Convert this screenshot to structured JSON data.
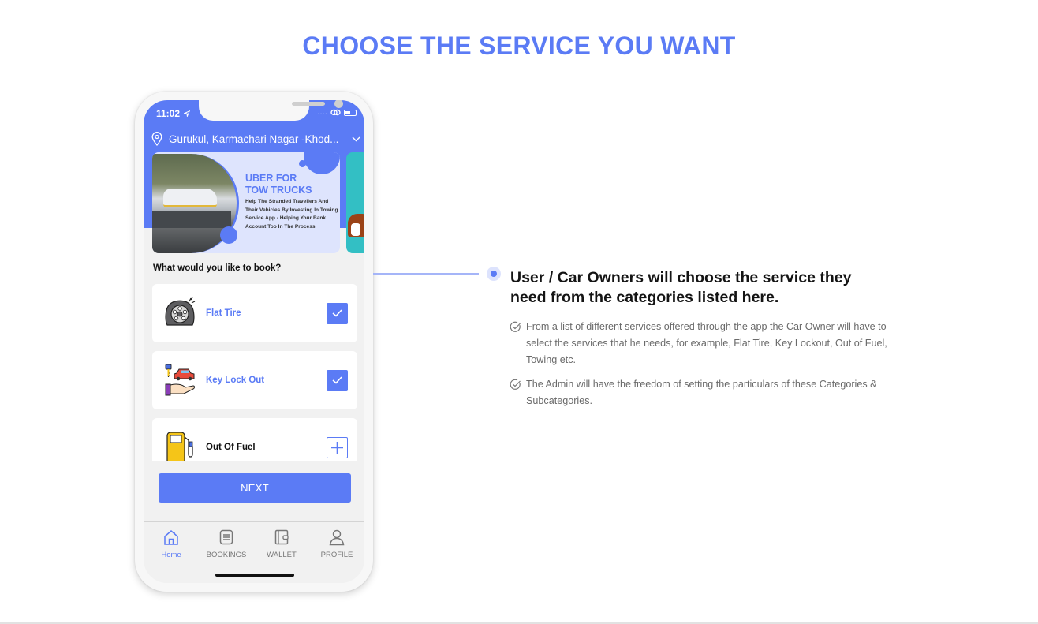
{
  "page": {
    "title": "CHOOSE THE SERVICE YOU WANT"
  },
  "colors": {
    "accent": "#5b7bf5",
    "accent_light": "#dde3fd",
    "connector": "#a5b5f8",
    "text_dark": "#141414",
    "text_muted": "#6a6a6a"
  },
  "phone": {
    "status_bar": {
      "time": "11:02",
      "signal": "....",
      "icons": [
        "location-arrow-icon",
        "link-icon",
        "battery-icon"
      ]
    },
    "location": {
      "icon": "map-pin-icon",
      "text": "Gurukul, Karmachari Nagar -Khod...",
      "dropdown_icon": "chevron-down-icon"
    },
    "banner": {
      "heading_line1": "UBER FOR",
      "heading_line2": "TOW TRUCKS",
      "subtext": "Help The Stranded Travellers And Their Vehicles By Investing In Towing Service App - Helping Your Bank Account Too In The Process"
    },
    "booking_prompt": "What would you like to book?",
    "services": [
      {
        "label": "Flat Tire",
        "icon": "flat-tire-icon",
        "selected": true
      },
      {
        "label": "Key Lock Out",
        "icon": "key-lockout-icon",
        "selected": true
      },
      {
        "label": "Out Of Fuel",
        "icon": "fuel-pump-icon",
        "selected": false
      }
    ],
    "next_button": "NEXT",
    "tabs": [
      {
        "label": "Home",
        "icon": "home-icon",
        "active": true
      },
      {
        "label": "BOOKINGS",
        "icon": "bookings-icon",
        "active": false
      },
      {
        "label": "WALLET",
        "icon": "wallet-icon",
        "active": false
      },
      {
        "label": "PROFILE",
        "icon": "profile-icon",
        "active": false
      }
    ]
  },
  "feature": {
    "heading": "User / Car Owners will choose the service they need from the categories listed here.",
    "points": [
      "From a list of different services offered through the app the Car Owner will have to select the services that he needs, for example, Flat Tire, Key Lockout, Out of Fuel, Towing etc.",
      "The Admin will have the freedom of setting the particulars of these Categories & Subcategories."
    ]
  }
}
